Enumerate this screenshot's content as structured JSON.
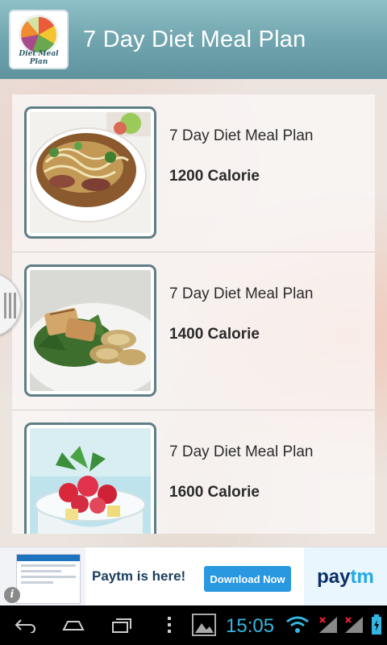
{
  "app": {
    "title": "7 Day Diet Meal Plan",
    "icon_caption": "Diet Meal Plan",
    "icon_name": "app-logo-icon",
    "accent_color": "#6fa3ad"
  },
  "list": {
    "items": [
      {
        "title": "7 Day Diet Meal Plan",
        "subtitle": "1200 Calorie",
        "image": "noodle-soup-image"
      },
      {
        "title": "7 Day Diet Meal Plan",
        "subtitle": "1400 Calorie",
        "image": "chicken-salad-image"
      },
      {
        "title": "7 Day Diet Meal Plan",
        "subtitle": "1600 Calorie",
        "image": "berry-parfait-image"
      }
    ]
  },
  "ad": {
    "headline": "Paytm is here!",
    "button_label": "Download Now",
    "logo_part1": "pay",
    "logo_part2": "tm",
    "info_glyph": "i"
  },
  "status_bar": {
    "time": "15:05",
    "clock_color": "#35b6e2",
    "icons": [
      "back-icon",
      "home-icon",
      "recent-apps-icon",
      "menu-icon",
      "gallery-icon",
      "wifi-icon",
      "signal-icon",
      "signal-icon",
      "battery-icon"
    ]
  }
}
